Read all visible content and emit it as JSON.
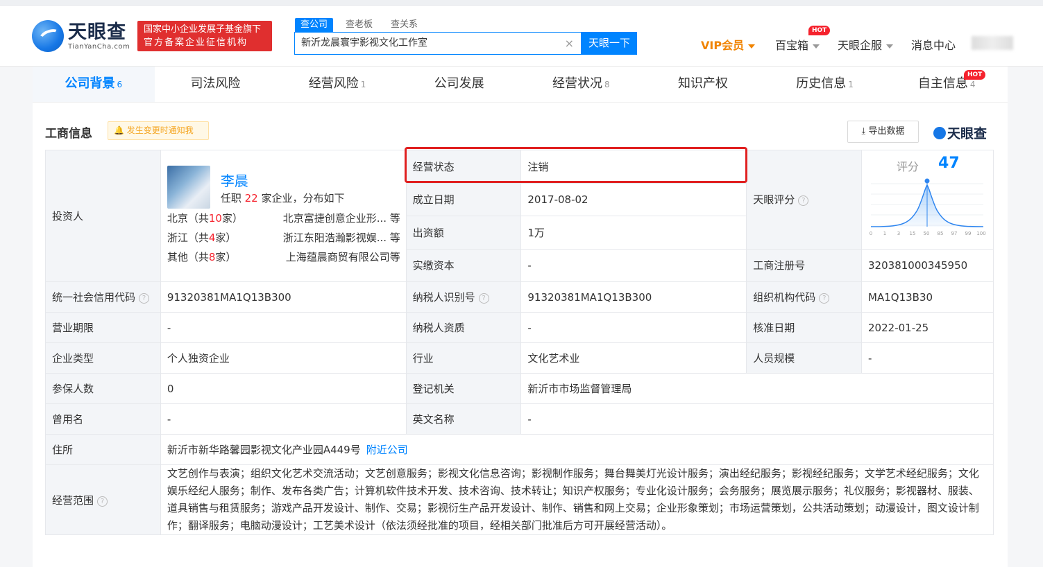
{
  "header": {
    "logo_cn": "天眼查",
    "logo_en": "TianYanCha.com",
    "banner_line1": "国家中小企业发展子基金旗下",
    "banner_line2": "官方备案企业征信机构",
    "search_tabs": [
      "查公司",
      "查老板",
      "查关系"
    ],
    "search_value": "新沂龙晨寰宇影视文化工作室",
    "search_button": "天眼一下",
    "clear": "×",
    "nav": {
      "vip": "VIP会员",
      "baobao": "百宝箱",
      "hot": "HOT",
      "qifu": "天眼企服",
      "msg": "消息中心"
    }
  },
  "tabs": [
    {
      "label": "公司背景",
      "count": "6"
    },
    {
      "label": "司法风险",
      "count": ""
    },
    {
      "label": "经营风险",
      "count": "1"
    },
    {
      "label": "公司发展",
      "count": ""
    },
    {
      "label": "经营状况",
      "count": "8"
    },
    {
      "label": "知识产权",
      "count": ""
    },
    {
      "label": "历史信息",
      "count": "1"
    },
    {
      "label": "自主信息",
      "count": "4"
    }
  ],
  "tab_hot": "HOT",
  "section": {
    "title": "工商信息",
    "notify": "发生变更时通知我",
    "export": "导出数据",
    "brand": "天眼查"
  },
  "investor": {
    "label": "投资人",
    "name": "李晨",
    "sub_pre": "任职 ",
    "sub_num": "22",
    "sub_post": " 家企业，分布如下",
    "rows": [
      {
        "region": "北京（共",
        "n": "10",
        "suffix": "家）",
        "company": "北京富捷创意企业形...  等"
      },
      {
        "region": "浙江（共",
        "n": "4",
        "suffix": "家）",
        "company": "浙江东阳浩瀚影视娱...  等"
      },
      {
        "region": "其他（共",
        "n": "8",
        "suffix": "家）",
        "company": "上海蕴晨商贸有限公司等"
      }
    ]
  },
  "fields": {
    "status_l": "经营状态",
    "status_v": "注销",
    "found_l": "成立日期",
    "found_v": "2017-08-02",
    "capital_l": "出资额",
    "capital_v": "1万",
    "paid_l": "实缴资本",
    "paid_v": "-",
    "score_l": "天眼评分",
    "score_lab": "评分",
    "score_v": "47",
    "score_ticks": [
      "0",
      "1",
      "3",
      "15",
      "50",
      "85",
      "97",
      "99",
      "100"
    ],
    "regno_l": "工商注册号",
    "regno_v": "320381000345950",
    "credit_l": "统一社会信用代码",
    "credit_v": "91320381MA1Q13B300",
    "taxid_l": "纳税人识别号",
    "taxid_v": "91320381MA1Q13B300",
    "org_l": "组织机构代码",
    "org_v": "MA1Q13B30",
    "term_l": "营业期限",
    "term_v": "-",
    "taxq_l": "纳税人资质",
    "taxq_v": "-",
    "approve_l": "核准日期",
    "approve_v": "2022-01-25",
    "type_l": "企业类型",
    "type_v": "个人独资企业",
    "industry_l": "行业",
    "industry_v": "文化艺术业",
    "staff_l": "人员规模",
    "staff_v": "-",
    "insured_l": "参保人数",
    "insured_v": "0",
    "authority_l": "登记机关",
    "authority_v": "新沂市市场监督管理局",
    "former_l": "曾用名",
    "former_v": "-",
    "en_l": "英文名称",
    "en_v": "-",
    "addr_l": "住所",
    "addr_v": "新沂市新华路馨园影视文化产业园A449号",
    "addr_link": "附近公司",
    "scope_l": "经营范围",
    "scope_v": "文艺创作与表演；组织文化艺术交流活动；文艺创意服务；影视文化信息咨询；影视制作服务；舞台舞美灯光设计服务；演出经纪服务；影视经纪服务；文学艺术经纪服务；文化娱乐经纪人服务；制作、发布各类广告；计算机软件技术开发、技术咨询、技术转让；知识产权服务；专业化设计服务；会务服务；展览展示服务；礼仪服务；影视器材、服装、道具销售与租赁服务；游戏产品开发设计、制作、交易；影视衍生产品开发设计、制作、销售和网上交易；企业形象策划；市场运营策划，公共活动策划；动漫设计，图文设计制作；翻译服务；电脑动漫设计；工艺美术设计（依法须经批准的项目，经相关部门批准后方可开展经营活动）。"
  },
  "colors": {
    "accent": "#0084ff",
    "highlight_box": "#e02020",
    "vip": "#f08300"
  }
}
